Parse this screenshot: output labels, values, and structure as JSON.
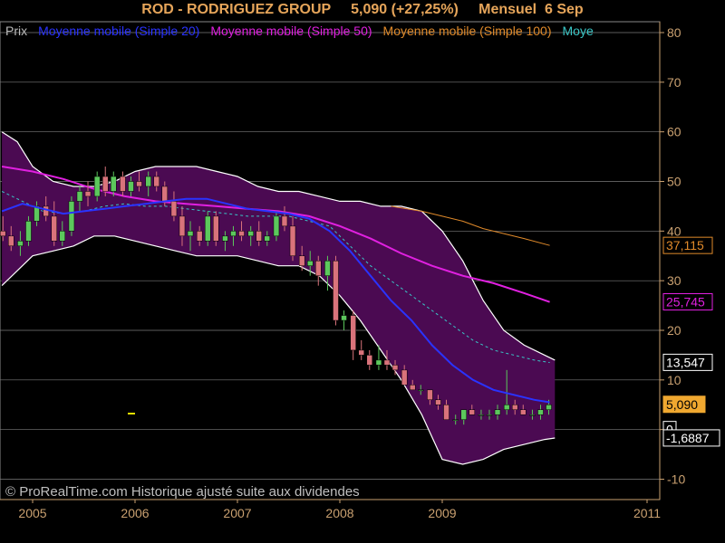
{
  "header": {
    "symbol": "ROD - RODRIGUEZ GROUP",
    "price_change": "5,090 (+27,25%)",
    "period": "Mensuel",
    "date": "6 Sep"
  },
  "footer": {
    "copyright": "© ProRealTime.com Historique ajusté suite aux dividendes"
  },
  "legend": [
    {
      "label": "Prix",
      "color": "#bbbbbb"
    },
    {
      "label": "Moyenne mobile (Simple 20)",
      "color": "#2a33ff"
    },
    {
      "label": "Moyenne mobile (Simple 50)",
      "color": "#e020e0"
    },
    {
      "label": "Moyenne mobile (Simple 100)",
      "color": "#e08a2a"
    },
    {
      "label": "Moye",
      "color": "#39c6c6"
    }
  ],
  "colors": {
    "background": "#000000",
    "band_fill": "#4b0a52",
    "band_edge": "#ffffff",
    "up_candle": "#5cc85c",
    "down_candle": "#d9737b",
    "axis": "#c9a070",
    "gridline": "#7a7a7a",
    "text": "#e6a55a"
  },
  "chart_data": {
    "type": "line",
    "title": "ROD - RODRIGUEZ GROUP",
    "x_range": [
      2004.7,
      2011.95
    ],
    "ylim": [
      -12,
      82
    ],
    "y_ticks": [
      -10,
      0,
      10,
      20,
      30,
      40,
      50,
      60,
      70,
      80
    ],
    "y_tick_labels": [
      "-10",
      "0",
      "10",
      "20",
      "30",
      "40",
      "50",
      "60",
      "70",
      "80"
    ],
    "x_ticks": [
      2005,
      2006,
      2007,
      2008,
      2009,
      2011
    ],
    "x_tick_labels": [
      "2005",
      "2006",
      "2007",
      "2008",
      "2009",
      "2011"
    ],
    "grid": true,
    "value_labels": [
      {
        "text": "37,115",
        "value": 37.115,
        "color": "#e08a2a",
        "boxed": true
      },
      {
        "text": "25,745",
        "value": 25.745,
        "color": "#e020e0",
        "boxed": true
      },
      {
        "text": "13,547",
        "value": 13.547,
        "color": "#ffffff",
        "boxed": true
      },
      {
        "text": "5,090",
        "value": 5.09,
        "color": "#000000",
        "bg": "#f0a830",
        "boxed": true
      },
      {
        "text": "0",
        "value": 0,
        "color": "#ffffff",
        "boxed": true
      },
      {
        "text": "-1,6887",
        "value": -1.6887,
        "color": "#ffffff",
        "boxed": true
      }
    ],
    "candles": [
      {
        "t": 2004.71,
        "o": 40,
        "h": 43,
        "l": 38,
        "c": 39
      },
      {
        "t": 2004.79,
        "o": 39,
        "h": 41,
        "l": 36,
        "c": 37
      },
      {
        "t": 2004.88,
        "o": 37,
        "h": 40,
        "l": 35,
        "c": 38
      },
      {
        "t": 2004.96,
        "o": 38,
        "h": 43,
        "l": 37,
        "c": 42
      },
      {
        "t": 2005.04,
        "o": 42,
        "h": 46,
        "l": 41,
        "c": 45
      },
      {
        "t": 2005.13,
        "o": 45,
        "h": 47,
        "l": 42,
        "c": 43
      },
      {
        "t": 2005.21,
        "o": 43,
        "h": 46,
        "l": 37,
        "c": 38
      },
      {
        "t": 2005.29,
        "o": 38,
        "h": 42,
        "l": 37,
        "c": 40
      },
      {
        "t": 2005.38,
        "o": 40,
        "h": 47,
        "l": 39,
        "c": 46
      },
      {
        "t": 2005.46,
        "o": 46,
        "h": 49,
        "l": 44,
        "c": 48
      },
      {
        "t": 2005.54,
        "o": 48,
        "h": 50,
        "l": 45,
        "c": 47
      },
      {
        "t": 2005.63,
        "o": 47,
        "h": 52,
        "l": 46,
        "c": 51
      },
      {
        "t": 2005.71,
        "o": 51,
        "h": 53,
        "l": 47,
        "c": 48
      },
      {
        "t": 2005.79,
        "o": 48,
        "h": 52,
        "l": 47,
        "c": 51
      },
      {
        "t": 2005.88,
        "o": 51,
        "h": 52,
        "l": 47,
        "c": 48
      },
      {
        "t": 2005.96,
        "o": 48,
        "h": 51,
        "l": 47,
        "c": 50
      },
      {
        "t": 2006.04,
        "o": 50,
        "h": 52,
        "l": 48,
        "c": 49
      },
      {
        "t": 2006.13,
        "o": 49,
        "h": 52,
        "l": 47,
        "c": 51
      },
      {
        "t": 2006.21,
        "o": 51,
        "h": 52,
        "l": 48,
        "c": 49
      },
      {
        "t": 2006.29,
        "o": 49,
        "h": 50,
        "l": 45,
        "c": 46
      },
      {
        "t": 2006.38,
        "o": 46,
        "h": 48,
        "l": 42,
        "c": 43
      },
      {
        "t": 2006.46,
        "o": 43,
        "h": 45,
        "l": 37,
        "c": 39
      },
      {
        "t": 2006.54,
        "o": 39,
        "h": 42,
        "l": 36,
        "c": 40
      },
      {
        "t": 2006.63,
        "o": 40,
        "h": 41,
        "l": 37,
        "c": 38
      },
      {
        "t": 2006.71,
        "o": 38,
        "h": 44,
        "l": 37,
        "c": 43
      },
      {
        "t": 2006.79,
        "o": 43,
        "h": 44,
        "l": 37,
        "c": 38
      },
      {
        "t": 2006.88,
        "o": 38,
        "h": 40,
        "l": 36,
        "c": 39
      },
      {
        "t": 2006.96,
        "o": 39,
        "h": 41,
        "l": 37,
        "c": 40
      },
      {
        "t": 2007.04,
        "o": 40,
        "h": 42,
        "l": 38,
        "c": 39
      },
      {
        "t": 2007.13,
        "o": 39,
        "h": 41,
        "l": 37,
        "c": 40
      },
      {
        "t": 2007.21,
        "o": 40,
        "h": 42,
        "l": 37,
        "c": 38
      },
      {
        "t": 2007.29,
        "o": 38,
        "h": 40,
        "l": 37,
        "c": 39
      },
      {
        "t": 2007.38,
        "o": 39,
        "h": 44,
        "l": 38,
        "c": 43
      },
      {
        "t": 2007.46,
        "o": 43,
        "h": 45,
        "l": 40,
        "c": 41
      },
      {
        "t": 2007.54,
        "o": 41,
        "h": 43,
        "l": 34,
        "c": 35
      },
      {
        "t": 2007.63,
        "o": 35,
        "h": 37,
        "l": 32,
        "c": 33
      },
      {
        "t": 2007.71,
        "o": 33,
        "h": 36,
        "l": 31,
        "c": 34
      },
      {
        "t": 2007.79,
        "o": 34,
        "h": 35,
        "l": 29,
        "c": 31
      },
      {
        "t": 2007.88,
        "o": 31,
        "h": 35,
        "l": 28,
        "c": 34
      },
      {
        "t": 2007.96,
        "o": 34,
        "h": 35,
        "l": 21,
        "c": 22
      },
      {
        "t": 2008.04,
        "o": 22,
        "h": 24,
        "l": 20,
        "c": 23
      },
      {
        "t": 2008.13,
        "o": 23,
        "h": 24,
        "l": 14,
        "c": 16
      },
      {
        "t": 2008.21,
        "o": 16,
        "h": 18,
        "l": 14,
        "c": 15
      },
      {
        "t": 2008.29,
        "o": 15,
        "h": 16,
        "l": 12,
        "c": 13
      },
      {
        "t": 2008.38,
        "o": 13,
        "h": 17,
        "l": 12,
        "c": 14
      },
      {
        "t": 2008.46,
        "o": 14,
        "h": 16,
        "l": 12,
        "c": 13
      },
      {
        "t": 2008.54,
        "o": 13,
        "h": 14,
        "l": 11,
        "c": 12
      },
      {
        "t": 2008.63,
        "o": 12,
        "h": 13,
        "l": 9,
        "c": 9
      },
      {
        "t": 2008.71,
        "o": 9,
        "h": 10,
        "l": 8,
        "c": 8
      },
      {
        "t": 2008.79,
        "o": 8,
        "h": 9,
        "l": 7,
        "c": 8
      },
      {
        "t": 2008.88,
        "o": 8,
        "h": 8,
        "l": 5,
        "c": 6
      },
      {
        "t": 2008.96,
        "o": 6,
        "h": 7,
        "l": 4,
        "c": 5
      },
      {
        "t": 2009.04,
        "o": 5,
        "h": 6,
        "l": 2,
        "c": 2
      },
      {
        "t": 2009.13,
        "o": 2,
        "h": 3,
        "l": 1,
        "c": 2
      },
      {
        "t": 2009.21,
        "o": 2,
        "h": 4,
        "l": 1,
        "c": 4
      },
      {
        "t": 2009.29,
        "o": 4,
        "h": 5,
        "l": 3,
        "c": 3
      },
      {
        "t": 2009.38,
        "o": 3,
        "h": 4,
        "l": 2,
        "c": 3
      },
      {
        "t": 2009.46,
        "o": 3,
        "h": 4,
        "l": 2,
        "c": 3
      },
      {
        "t": 2009.54,
        "o": 3,
        "h": 5,
        "l": 2,
        "c": 4
      },
      {
        "t": 2009.63,
        "o": 4,
        "h": 12,
        "l": 3,
        "c": 5
      },
      {
        "t": 2009.71,
        "o": 5,
        "h": 6,
        "l": 3,
        "c": 4
      },
      {
        "t": 2009.79,
        "o": 4,
        "h": 5,
        "l": 3,
        "c": 3
      },
      {
        "t": 2009.88,
        "o": 3,
        "h": 4,
        "l": 2,
        "c": 3
      },
      {
        "t": 2009.96,
        "o": 3,
        "h": 5,
        "l": 2,
        "c": 4
      },
      {
        "t": 2010.04,
        "o": 4,
        "h": 6,
        "l": 3,
        "c": 5
      }
    ],
    "series": [
      {
        "key": "boll_upper",
        "color": "#ffffff",
        "x": [
          2004.7,
          2004.85,
          2005.0,
          2005.2,
          2005.4,
          2005.6,
          2005.8,
          2006.0,
          2006.2,
          2006.4,
          2006.6,
          2006.8,
          2007.0,
          2007.2,
          2007.4,
          2007.6,
          2007.8,
          2008.0,
          2008.2,
          2008.4,
          2008.6,
          2008.8,
          2009.0,
          2009.2,
          2009.4,
          2009.6,
          2009.8,
          2010.0,
          2010.1
        ],
        "values": [
          60,
          58,
          53,
          50,
          49,
          49,
          50,
          52,
          53,
          53,
          53,
          52,
          51,
          49,
          48,
          48,
          47,
          46,
          46,
          45,
          45,
          44,
          40,
          34,
          26,
          20,
          17,
          15,
          14
        ]
      },
      {
        "key": "boll_lower",
        "color": "#ffffff",
        "x": [
          2004.7,
          2004.85,
          2005.0,
          2005.2,
          2005.4,
          2005.6,
          2005.8,
          2006.0,
          2006.2,
          2006.4,
          2006.6,
          2006.8,
          2007.0,
          2007.2,
          2007.4,
          2007.6,
          2007.8,
          2008.0,
          2008.2,
          2008.4,
          2008.6,
          2008.8,
          2009.0,
          2009.2,
          2009.4,
          2009.6,
          2009.8,
          2010.0,
          2010.1
        ],
        "values": [
          29,
          32,
          35,
          36,
          37,
          39,
          39,
          38,
          37,
          36,
          35,
          35,
          35,
          34,
          33,
          33,
          31,
          27,
          22,
          16,
          10,
          3,
          -6,
          -7,
          -6,
          -4,
          -3,
          -2,
          -1.7
        ]
      },
      {
        "key": "sma20",
        "color": "#2a33ff",
        "width": 2,
        "x": [
          2004.7,
          2004.9,
          2005.1,
          2005.3,
          2005.5,
          2005.7,
          2005.9,
          2006.1,
          2006.3,
          2006.5,
          2006.7,
          2006.9,
          2007.1,
          2007.3,
          2007.5,
          2007.7,
          2007.9,
          2008.1,
          2008.3,
          2008.5,
          2008.7,
          2008.9,
          2009.1,
          2009.3,
          2009.5,
          2009.7,
          2009.9,
          2010.05
        ],
        "values": [
          44,
          45.5,
          44.5,
          43.5,
          44,
          44.5,
          45,
          45.5,
          46,
          46.5,
          46.5,
          45.5,
          44.5,
          44,
          43.5,
          42.5,
          40,
          36,
          31,
          26,
          22,
          17,
          13,
          10,
          8,
          7,
          6,
          5.5
        ]
      },
      {
        "key": "sma20_dashed",
        "color": "#39c6c6",
        "width": 1,
        "dashed": true,
        "x": [
          2004.7,
          2004.9,
          2005.1,
          2005.3,
          2005.5,
          2005.7,
          2005.9,
          2006.1,
          2006.3,
          2006.5,
          2006.7,
          2006.9,
          2007.1,
          2007.3,
          2007.5,
          2007.7,
          2007.9,
          2008.1,
          2008.3,
          2008.5,
          2008.7,
          2008.9,
          2009.1,
          2009.3,
          2009.5,
          2009.7,
          2009.9,
          2010.05
        ],
        "values": [
          48,
          46,
          44,
          43.5,
          44,
          45,
          45.5,
          45,
          45,
          44.5,
          44,
          43.5,
          43,
          43,
          43,
          42,
          41,
          37,
          33,
          30,
          27,
          24,
          21,
          18,
          16,
          15,
          14,
          13.5
        ]
      },
      {
        "key": "sma50",
        "color": "#e020e0",
        "width": 2,
        "x": [
          2004.7,
          2005.0,
          2005.3,
          2005.6,
          2005.9,
          2006.2,
          2006.5,
          2006.8,
          2007.1,
          2007.4,
          2007.7,
          2008.0,
          2008.3,
          2008.6,
          2008.9,
          2009.2,
          2009.5,
          2009.8,
          2010.05
        ],
        "values": [
          53,
          52,
          50.5,
          48.5,
          47,
          46,
          45.5,
          45,
          44.5,
          44,
          43,
          41,
          38.5,
          35.5,
          33,
          31,
          29.5,
          27.5,
          25.7
        ]
      },
      {
        "key": "sma100",
        "color": "#e08a2a",
        "width": 1,
        "x": [
          2008.5,
          2008.8,
          2009.0,
          2009.2,
          2009.4,
          2009.6,
          2009.8,
          2010.05
        ],
        "values": [
          45,
          44,
          43,
          42,
          40.5,
          39.5,
          38.5,
          37.1
        ]
      }
    ]
  }
}
